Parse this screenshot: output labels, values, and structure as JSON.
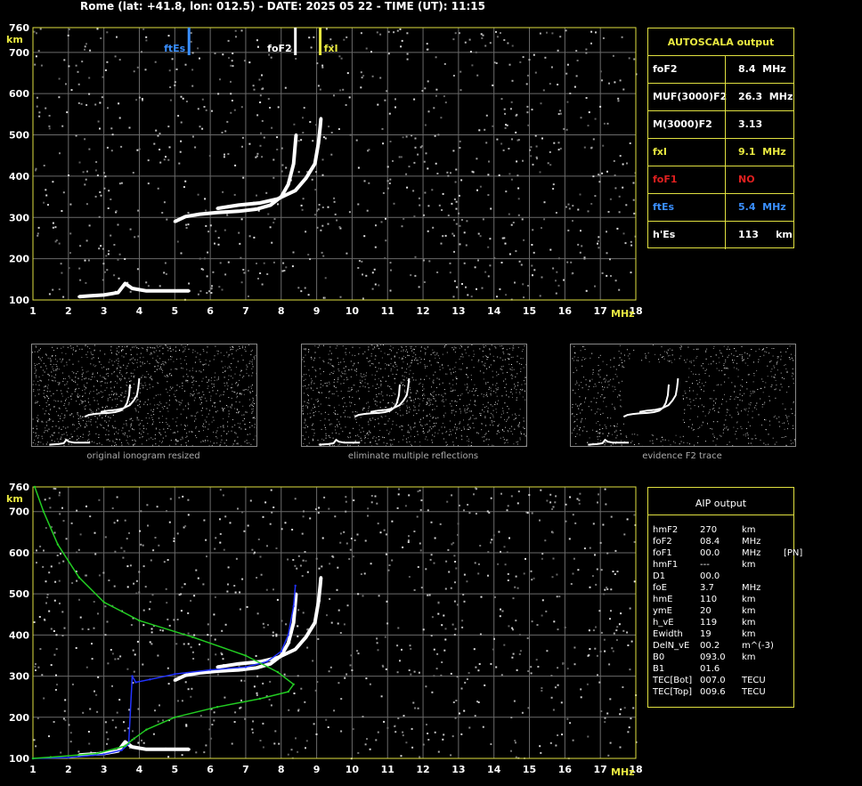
{
  "header": "Rome (lat: +41.8, lon: 012.5) - DATE: 2025 05 22 - TIME (UT): 11:15",
  "autoscala": {
    "title": "AUTOSCALA output",
    "rows": [
      {
        "name": "foF2",
        "value": "8.4  MHz",
        "color": "#ffffff"
      },
      {
        "name": "MUF(3000)F2",
        "value": "26.3  MHz",
        "color": "#ffffff"
      },
      {
        "name": "M(3000)F2",
        "value": "3.13",
        "color": "#ffffff"
      },
      {
        "name": "fxI",
        "value": "9.1  MHz",
        "color": "#e8e840"
      },
      {
        "name": "foF1",
        "value": "NO",
        "color": "#e02020"
      },
      {
        "name": "ftEs",
        "value": "5.4  MHz",
        "color": "#3a8fff"
      },
      {
        "name": "h'Es",
        "value": "113     km",
        "color": "#ffffff"
      }
    ]
  },
  "aip": {
    "title": "AIP output",
    "rows": [
      [
        "hmF2",
        "270",
        "km",
        ""
      ],
      [
        "foF2",
        "08.4",
        "MHz",
        ""
      ],
      [
        "foF1",
        "00.0",
        "MHz",
        "[PN]"
      ],
      [
        "hmF1",
        "---",
        "km",
        ""
      ],
      [
        "D1",
        "00.0",
        "",
        ""
      ],
      [
        "foE",
        "3.7",
        "MHz",
        ""
      ],
      [
        "hmE",
        "110",
        "km",
        ""
      ],
      [
        "ymE",
        "20",
        "km",
        ""
      ],
      [
        "h_vE",
        "119",
        "km",
        ""
      ],
      [
        "Ewidth",
        "19",
        "km",
        ""
      ],
      [
        "DelN_vE",
        "00.2",
        "m^(-3)",
        ""
      ],
      [
        "B0",
        "093.0",
        "km",
        ""
      ],
      [
        "B1",
        "01.6",
        "",
        ""
      ],
      [
        "TEC[Bot]",
        "007.0",
        "TECU",
        ""
      ],
      [
        "TEC[Top]",
        "009.6",
        "TECU",
        ""
      ]
    ]
  },
  "thumbnails": [
    {
      "caption": "original ionogram resized"
    },
    {
      "caption": "eliminate multiple reflections"
    },
    {
      "caption": "evidence F2 trace"
    }
  ],
  "chart_data": [
    {
      "type": "scatter",
      "xlabel": "MHz",
      "ylabel": "km",
      "xlim": [
        1,
        18
      ],
      "ylim": [
        100,
        760
      ],
      "xticks": [
        1,
        2,
        3,
        4,
        5,
        6,
        7,
        8,
        9,
        10,
        11,
        12,
        13,
        14,
        15,
        16,
        17,
        18
      ],
      "yticks": [
        100,
        200,
        300,
        400,
        500,
        600,
        700,
        760
      ],
      "markers": [
        {
          "label": "ftEs",
          "x": 5.4,
          "color": "#3a8fff"
        },
        {
          "label": "foF2",
          "x": 8.4,
          "color": "#ffffff"
        },
        {
          "label": "fxI",
          "x": 9.1,
          "color": "#e8e840"
        }
      ],
      "series": [
        {
          "name": "O trace",
          "color": "#ffffff",
          "points": [
            [
              5.0,
              290
            ],
            [
              5.3,
              302
            ],
            [
              5.7,
              308
            ],
            [
              6.2,
              312
            ],
            [
              6.8,
              315
            ],
            [
              7.3,
              320
            ],
            [
              7.7,
              330
            ],
            [
              8.0,
              350
            ],
            [
              8.2,
              380
            ],
            [
              8.35,
              430
            ],
            [
              8.4,
              480
            ],
            [
              8.42,
              500
            ]
          ]
        },
        {
          "name": "X trace",
          "color": "#ffffff",
          "points": [
            [
              6.2,
              322
            ],
            [
              6.8,
              330
            ],
            [
              7.4,
              335
            ],
            [
              7.9,
              345
            ],
            [
              8.4,
              365
            ],
            [
              8.7,
              395
            ],
            [
              8.95,
              430
            ],
            [
              9.05,
              480
            ],
            [
              9.1,
              520
            ],
            [
              9.12,
              540
            ]
          ]
        },
        {
          "name": "Es trace",
          "color": "#ffffff",
          "points": [
            [
              2.3,
              108
            ],
            [
              2.6,
              110
            ],
            [
              3.0,
              112
            ],
            [
              3.4,
              118
            ],
            [
              3.6,
              140
            ],
            [
              3.8,
              128
            ],
            [
              4.2,
              122
            ],
            [
              4.8,
              122
            ],
            [
              5.4,
              122
            ]
          ]
        }
      ]
    },
    {
      "type": "scatter",
      "xlabel": "MHz",
      "ylabel": "km",
      "xlim": [
        1,
        18
      ],
      "ylim": [
        100,
        760
      ],
      "xticks": [
        1,
        2,
        3,
        4,
        5,
        6,
        7,
        8,
        9,
        10,
        11,
        12,
        13,
        14,
        15,
        16,
        17,
        18
      ],
      "yticks": [
        100,
        200,
        300,
        400,
        500,
        600,
        700,
        760
      ],
      "series": [
        {
          "name": "O trace",
          "color": "#ffffff",
          "points": [
            [
              5.0,
              290
            ],
            [
              5.3,
              302
            ],
            [
              5.7,
              308
            ],
            [
              6.2,
              312
            ],
            [
              6.8,
              315
            ],
            [
              7.3,
              320
            ],
            [
              7.7,
              330
            ],
            [
              8.0,
              350
            ],
            [
              8.2,
              380
            ],
            [
              8.35,
              430
            ],
            [
              8.4,
              480
            ],
            [
              8.42,
              500
            ]
          ]
        },
        {
          "name": "X trace",
          "color": "#ffffff",
          "points": [
            [
              6.2,
              322
            ],
            [
              6.8,
              330
            ],
            [
              7.4,
              335
            ],
            [
              7.9,
              345
            ],
            [
              8.4,
              365
            ],
            [
              8.7,
              395
            ],
            [
              8.95,
              430
            ],
            [
              9.05,
              480
            ],
            [
              9.1,
              520
            ],
            [
              9.12,
              540
            ]
          ]
        },
        {
          "name": "Es trace",
          "color": "#ffffff",
          "points": [
            [
              2.3,
              108
            ],
            [
              2.6,
              110
            ],
            [
              3.0,
              112
            ],
            [
              3.4,
              118
            ],
            [
              3.6,
              140
            ],
            [
              3.8,
              128
            ],
            [
              4.2,
              122
            ],
            [
              4.8,
              122
            ],
            [
              5.4,
              122
            ]
          ]
        },
        {
          "name": "AIP virtual height",
          "color": "#2233ff",
          "points": [
            [
              1.0,
              100
            ],
            [
              2.0,
              102
            ],
            [
              3.0,
              110
            ],
            [
              3.5,
              120
            ],
            [
              3.7,
              135
            ],
            [
              3.8,
              300
            ],
            [
              3.9,
              285
            ],
            [
              4.3,
              292
            ],
            [
              5.0,
              305
            ],
            [
              6.0,
              315
            ],
            [
              7.0,
              322
            ],
            [
              7.6,
              335
            ],
            [
              8.0,
              360
            ],
            [
              8.2,
              400
            ],
            [
              8.35,
              470
            ],
            [
              8.4,
              520
            ]
          ]
        },
        {
          "name": "AIP profile",
          "color": "#22cc22",
          "points": [
            [
              1.05,
              760
            ],
            [
              1.3,
              700
            ],
            [
              1.7,
              620
            ],
            [
              2.3,
              540
            ],
            [
              3.0,
              480
            ],
            [
              4.0,
              435
            ],
            [
              5.5,
              395
            ],
            [
              7.0,
              350
            ],
            [
              7.9,
              310
            ],
            [
              8.35,
              280
            ],
            [
              8.2,
              262
            ],
            [
              7.4,
              245
            ],
            [
              6.2,
              225
            ],
            [
              5.0,
              200
            ],
            [
              4.2,
              170
            ],
            [
              3.8,
              145
            ],
            [
              3.6,
              130
            ],
            [
              2.8,
              112
            ],
            [
              1.5,
              103
            ],
            [
              1.0,
              100
            ]
          ]
        }
      ]
    }
  ]
}
